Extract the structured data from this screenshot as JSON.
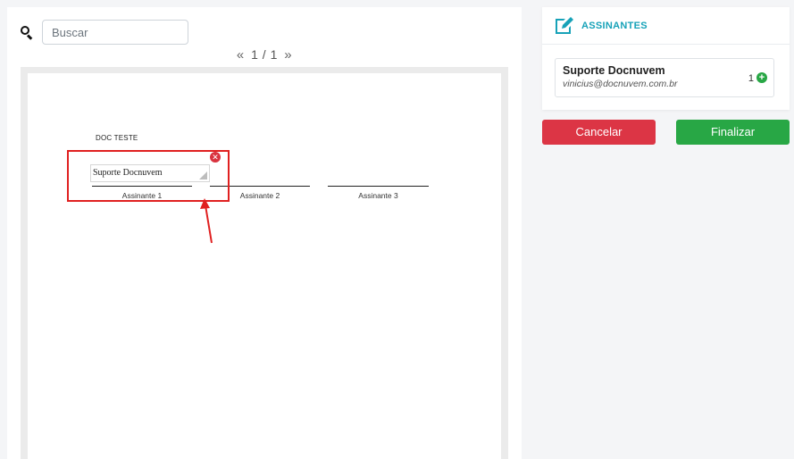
{
  "search": {
    "placeholder": "Buscar"
  },
  "pager": {
    "prev_symbol": "«",
    "current": "1 / 1",
    "next_symbol": "»"
  },
  "document": {
    "title": "DOC TESTE",
    "placed_signature": "Suporte Docnuvem",
    "signature_labels": [
      "Assinante 1",
      "Assinante 2",
      "Assinante 3"
    ]
  },
  "signers": {
    "title": "ASSINANTES",
    "items": [
      {
        "name": "Suporte Docnuvem",
        "email": "vinicius@docnuvem.com.br",
        "count": "1"
      }
    ]
  },
  "actions": {
    "cancel_label": "Cancelar",
    "finish_label": "Finalizar"
  },
  "colors": {
    "accent": "#17a2b8",
    "danger": "#dc3545",
    "success": "#28a745",
    "highlight": "#e02020"
  }
}
